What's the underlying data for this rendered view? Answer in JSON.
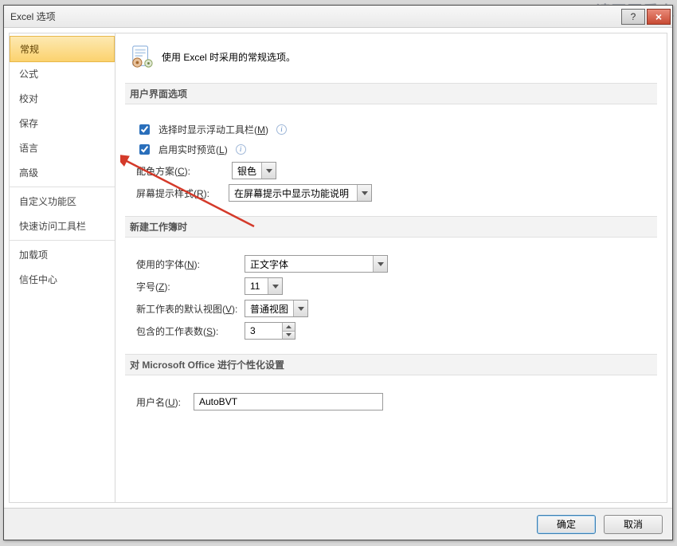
{
  "watermark": "请不要爱上",
  "titlebar": {
    "title": "Excel 选项",
    "help": "?",
    "close": "×"
  },
  "sidebar": {
    "items": [
      "常规",
      "公式",
      "校对",
      "保存",
      "语言",
      "高级",
      "自定义功能区",
      "快速访问工具栏",
      "加载项",
      "信任中心"
    ],
    "selected_index": 0
  },
  "intro": {
    "text": "使用 Excel 时采用的常规选项。"
  },
  "sections": {
    "ui": {
      "title": "用户界面选项",
      "chk_minitoolbar": {
        "label": "选择时显示浮动工具栏(",
        "hotkey": "M",
        "label_after": ")",
        "checked": true
      },
      "chk_livepreview": {
        "label": "启用实时预览(",
        "hotkey": "L",
        "label_after": ")",
        "checked": true
      },
      "color_scheme": {
        "label": "配色方案(",
        "hotkey": "C",
        "label_after": "):",
        "value": "银色"
      },
      "screentip": {
        "label": "屏幕提示样式(",
        "hotkey": "R",
        "label_after": "):",
        "value": "在屏幕提示中显示功能说明"
      }
    },
    "newwb": {
      "title": "新建工作簿时",
      "font": {
        "label": "使用的字体(",
        "hotkey": "N",
        "label_after": "):",
        "value": "正文字体"
      },
      "size": {
        "label": "字号(",
        "hotkey": "Z",
        "label_after": "):",
        "value": "11"
      },
      "default_view": {
        "label": "新工作表的默认视图(",
        "hotkey": "V",
        "label_after": "):",
        "value": "普通视图"
      },
      "sheet_count": {
        "label": "包含的工作表数(",
        "hotkey": "S",
        "label_after": "):",
        "value": "3"
      }
    },
    "personalize": {
      "title": "对 Microsoft Office 进行个性化设置",
      "username": {
        "label": "用户名(",
        "hotkey": "U",
        "label_after": "):",
        "value": "AutoBVT"
      }
    }
  },
  "footer": {
    "ok": "确定",
    "cancel": "取消"
  }
}
